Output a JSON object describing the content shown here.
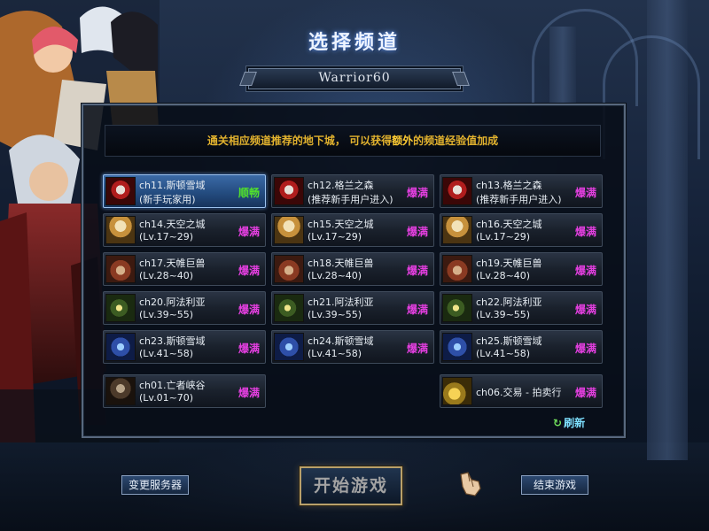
{
  "title": "选择频道",
  "character_name": "Warrior60",
  "notice": {
    "before": "通关相应频道推荐的地下城， 可以获得",
    "highlight": "额外",
    "after": "的频道经验值加成"
  },
  "channels": [
    {
      "name": "ch11.斯顿雪域",
      "sub": "(新手玩家用)",
      "status": "顺畅",
      "thumb": "red-haired-character",
      "selected": true
    },
    {
      "name": "ch12.格兰之森",
      "sub": "(推荐新手用户进入)",
      "status": "爆满",
      "thumb": "red-haired-character"
    },
    {
      "name": "ch13.格兰之森",
      "sub": "(推荐新手用户进入)",
      "status": "爆满",
      "thumb": "red-haired-character"
    },
    {
      "name": "ch14.天空之城",
      "sub": "(Lv.17~29)",
      "status": "爆满",
      "thumb": "sky-knight"
    },
    {
      "name": "ch15.天空之城",
      "sub": "(Lv.17~29)",
      "status": "爆满",
      "thumb": "sky-knight"
    },
    {
      "name": "ch16.天空之城",
      "sub": "(Lv.17~29)",
      "status": "爆满",
      "thumb": "sky-knight"
    },
    {
      "name": "ch17.天帷巨兽",
      "sub": "(Lv.28~40)",
      "status": "爆满",
      "thumb": "beast-crew"
    },
    {
      "name": "ch18.天帷巨兽",
      "sub": "(Lv.28~40)",
      "status": "爆满",
      "thumb": "beast-crew"
    },
    {
      "name": "ch19.天帷巨兽",
      "sub": "(Lv.28~40)",
      "status": "爆满",
      "thumb": "beast-crew"
    },
    {
      "name": "ch20.阿法利亚",
      "sub": "(Lv.39~55)",
      "status": "爆满",
      "thumb": "goblin-mask"
    },
    {
      "name": "ch21.阿法利亚",
      "sub": "(Lv.39~55)",
      "status": "爆满",
      "thumb": "goblin-mask"
    },
    {
      "name": "ch22.阿法利亚",
      "sub": "(Lv.39~55)",
      "status": "爆满",
      "thumb": "goblin-mask"
    },
    {
      "name": "ch23.斯顿雪域",
      "sub": "(Lv.41~58)",
      "status": "爆满",
      "thumb": "ice-dragon"
    },
    {
      "name": "ch24.斯顿雪域",
      "sub": "(Lv.41~58)",
      "status": "爆满",
      "thumb": "ice-dragon"
    },
    {
      "name": "ch25.斯顿雪域",
      "sub": "(Lv.41~58)",
      "status": "爆满",
      "thumb": "ice-dragon"
    },
    {
      "name": "ch01.亡者峡谷",
      "sub": "(Lv.01~70)",
      "status": "爆满",
      "thumb": "hooded-figure"
    },
    {
      "name": "ch06.交易 - 拍卖行",
      "sub": "",
      "status": "爆满",
      "thumb": "gold-coins"
    }
  ],
  "refresh_label": "刷新",
  "buttons": {
    "change_server": "变更服务器",
    "start_game": "开始游戏",
    "end_game": "结束游戏"
  },
  "colors": {
    "full": "#e43fe0",
    "smooth": "#52e32a",
    "notice": "#e2b22e"
  }
}
